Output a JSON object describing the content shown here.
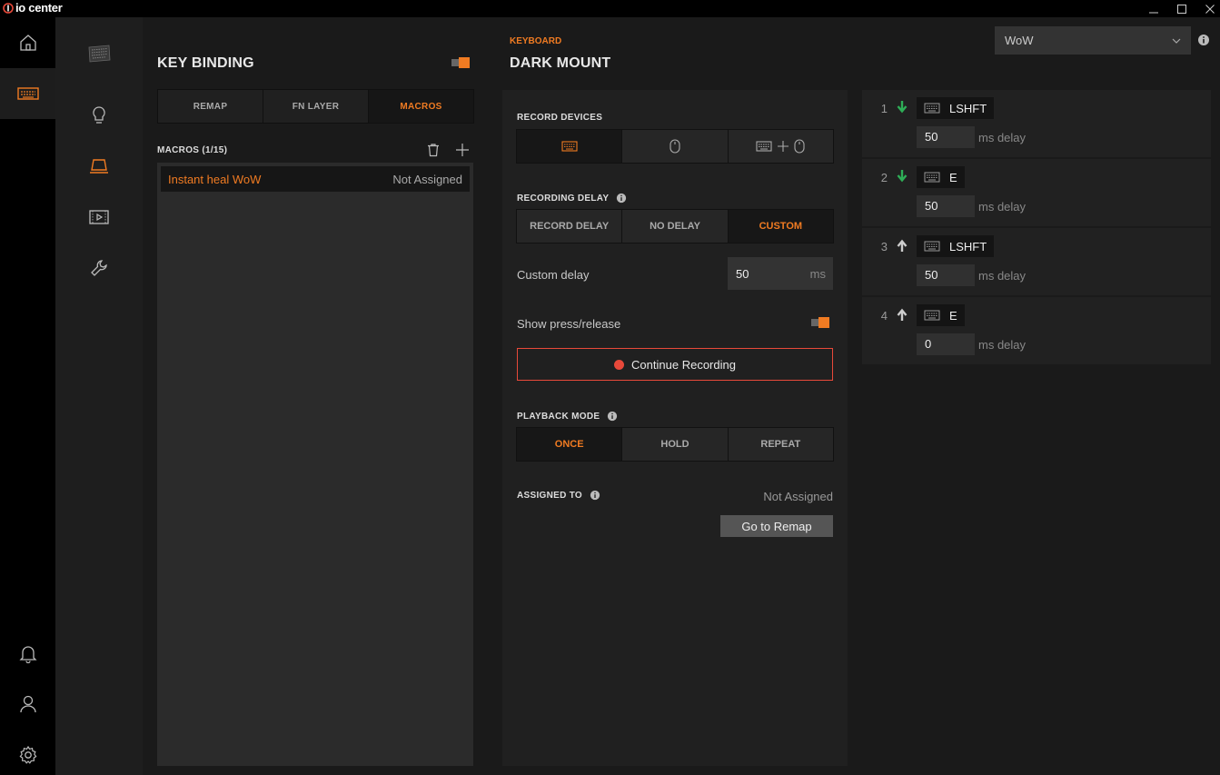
{
  "app": {
    "title": "io center"
  },
  "window": {
    "minimize": "minimize",
    "maximize": "maximize",
    "close": "close"
  },
  "nav": {
    "items": [
      {
        "name": "home",
        "icon": "home-icon"
      },
      {
        "name": "keyboard",
        "icon": "keyboard-icon",
        "active": true
      }
    ],
    "bottom": [
      {
        "name": "notifications",
        "icon": "bell-icon"
      },
      {
        "name": "profile",
        "icon": "user-icon"
      },
      {
        "name": "settings",
        "icon": "gear-icon"
      }
    ]
  },
  "submenu": {
    "items": [
      {
        "name": "device-image",
        "icon": "keyboard-thumbnail-icon"
      },
      {
        "name": "lighting",
        "icon": "bulb-icon"
      },
      {
        "name": "key-binding",
        "icon": "key-icon",
        "active": true
      },
      {
        "name": "media",
        "icon": "video-icon"
      },
      {
        "name": "tools",
        "icon": "wrench-icon"
      }
    ]
  },
  "key_binding": {
    "title": "KEY BINDING",
    "toggle_on": true,
    "tabs": [
      {
        "label": "REMAP",
        "active": false
      },
      {
        "label": "FN LAYER",
        "active": false
      },
      {
        "label": "MACROS",
        "active": true
      }
    ],
    "macros_header": "MACROS (1/15)",
    "macros": [
      {
        "name": "Instant heal WoW",
        "status": "Not Assigned"
      }
    ]
  },
  "header": {
    "category": "KEYBOARD",
    "device": "DARK MOUNT",
    "profile_select": "WoW"
  },
  "editor": {
    "record_devices_label": "RECORD DEVICES",
    "record_devices": [
      "keyboard",
      "mouse",
      "keyboard+mouse"
    ],
    "recording_delay_label": "RECORDING DELAY",
    "recording_delay_options": [
      {
        "label": "RECORD DELAY",
        "active": false
      },
      {
        "label": "NO DELAY",
        "active": false
      },
      {
        "label": "CUSTOM",
        "active": true
      }
    ],
    "custom_delay_label": "Custom delay",
    "custom_delay_value": "50",
    "custom_delay_unit": "ms",
    "show_press_release_label": "Show press/release",
    "continue_recording_label": "Continue Recording",
    "playback_mode_label": "PLAYBACK MODE",
    "playback_modes": [
      {
        "label": "ONCE",
        "active": true
      },
      {
        "label": "HOLD",
        "active": false
      },
      {
        "label": "REPEAT",
        "active": false
      }
    ],
    "assigned_to_label": "ASSIGNED TO",
    "assigned_to_value": "Not Assigned",
    "go_to_remap_label": "Go to Remap"
  },
  "steps": [
    {
      "num": "1",
      "direction": "down",
      "key": "LSHFT",
      "delay": "50",
      "delay_label": "ms delay"
    },
    {
      "num": "2",
      "direction": "down",
      "key": "E",
      "delay": "50",
      "delay_label": "ms delay"
    },
    {
      "num": "3",
      "direction": "up",
      "key": "LSHFT",
      "delay": "50",
      "delay_label": "ms delay"
    },
    {
      "num": "4",
      "direction": "up",
      "key": "E",
      "delay": "0",
      "delay_label": "ms delay"
    }
  ],
  "colors": {
    "accent": "#f07b22",
    "down_arrow": "#2eae57",
    "record_dot": "#e8493a"
  }
}
